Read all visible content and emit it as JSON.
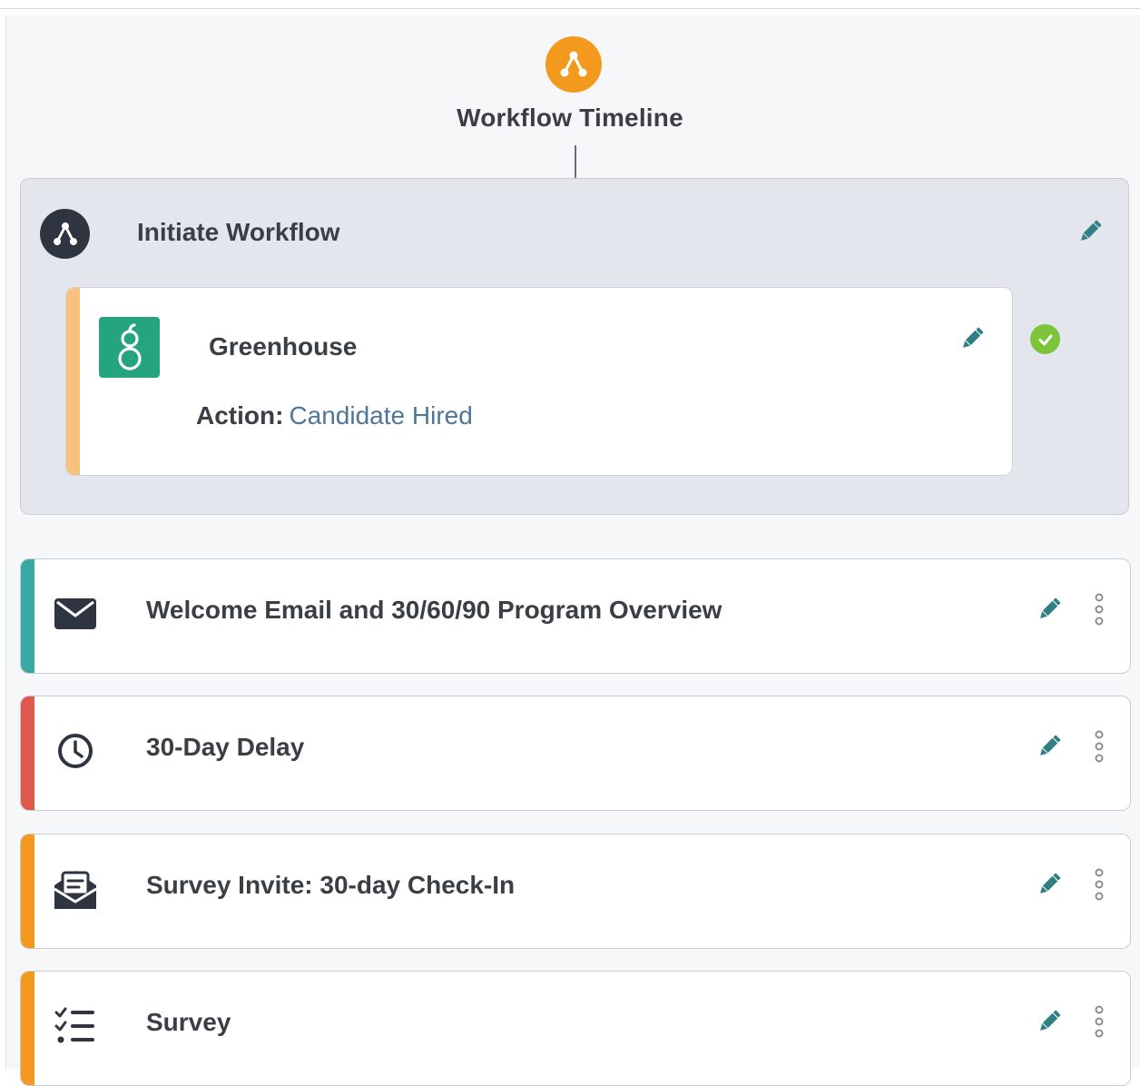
{
  "timeline": {
    "title": "Workflow Timeline",
    "icon": "workflow-icon",
    "icon_color": "#f39a1e"
  },
  "initiate": {
    "title": "Initiate Workflow",
    "icon": "workflow-icon",
    "trigger": {
      "app_name": "Greenhouse",
      "logo": "greenhouse-logo",
      "logo_color": "#24a47f",
      "accent_color": "#f7c27d",
      "action_label": "Action:",
      "action_value": "Candidate Hired",
      "status": "check-icon",
      "status_color": "#7cc43a"
    }
  },
  "steps": [
    {
      "title": "Welcome Email and 30/60/90 Program Overview",
      "icon": "envelope-icon",
      "accent_color": "#3aa9a5"
    },
    {
      "title": "30-Day Delay",
      "icon": "clock-icon",
      "accent_color": "#e0574b"
    },
    {
      "title": "Survey Invite: 30-day Check-In",
      "icon": "survey-invite-icon",
      "accent_color": "#f39a1e"
    },
    {
      "title": "Survey",
      "icon": "checklist-icon",
      "accent_color": "#f39a1e"
    }
  ],
  "colors": {
    "edit_icon": "#2f7f83",
    "text": "#3b3f45",
    "link": "#4e7697"
  }
}
